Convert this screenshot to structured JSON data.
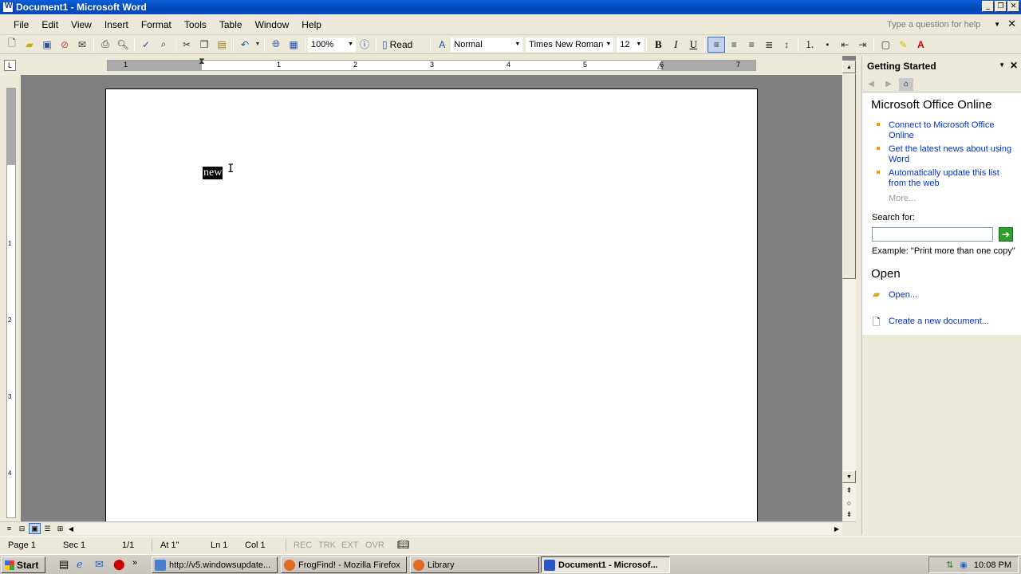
{
  "window": {
    "title": "Document1 - Microsoft Word"
  },
  "menu": {
    "items": [
      "File",
      "Edit",
      "View",
      "Insert",
      "Format",
      "Tools",
      "Table",
      "Window",
      "Help"
    ],
    "help_placeholder": "Type a question for help"
  },
  "toolbar": {
    "zoom": "100%",
    "read_label": "Read",
    "style": "Normal",
    "font": "Times New Roman",
    "font_size": "12",
    "bold": "B",
    "italic": "I",
    "underline": "U"
  },
  "ruler": {
    "h_numbers": [
      "1",
      "1",
      "2",
      "3",
      "4",
      "5",
      "6",
      "7"
    ],
    "v_numbers": [
      "1",
      "2",
      "3",
      "4"
    ]
  },
  "document": {
    "selected_text": "new"
  },
  "task_pane": {
    "title": "Getting Started",
    "section_online": "Microsoft Office Online",
    "links": [
      "Connect to Microsoft Office Online",
      "Get the latest news about using Word",
      "Automatically update this list from the web"
    ],
    "more": "More...",
    "search_label": "Search for:",
    "example": "Example:  \"Print more than one copy\"",
    "section_open": "Open",
    "open_link": "Open...",
    "new_doc_link": "Create a new document..."
  },
  "status": {
    "page": "Page 1",
    "sec": "Sec 1",
    "pages": "1/1",
    "at": "At 1\"",
    "ln": "Ln 1",
    "col": "Col 1",
    "rec": "REC",
    "trk": "TRK",
    "ext": "EXT",
    "ovr": "OVR"
  },
  "taskbar": {
    "start": "Start",
    "tasks": [
      "http://v5.windowsupdate...",
      "FrogFind! - Mozilla Firefox",
      "Library",
      "Document1 - Microsof..."
    ],
    "clock": "10:08 PM"
  },
  "colors": {
    "titlebar": "#0a5fd8",
    "link": "#0033cc",
    "bullet": "#ff9900"
  }
}
